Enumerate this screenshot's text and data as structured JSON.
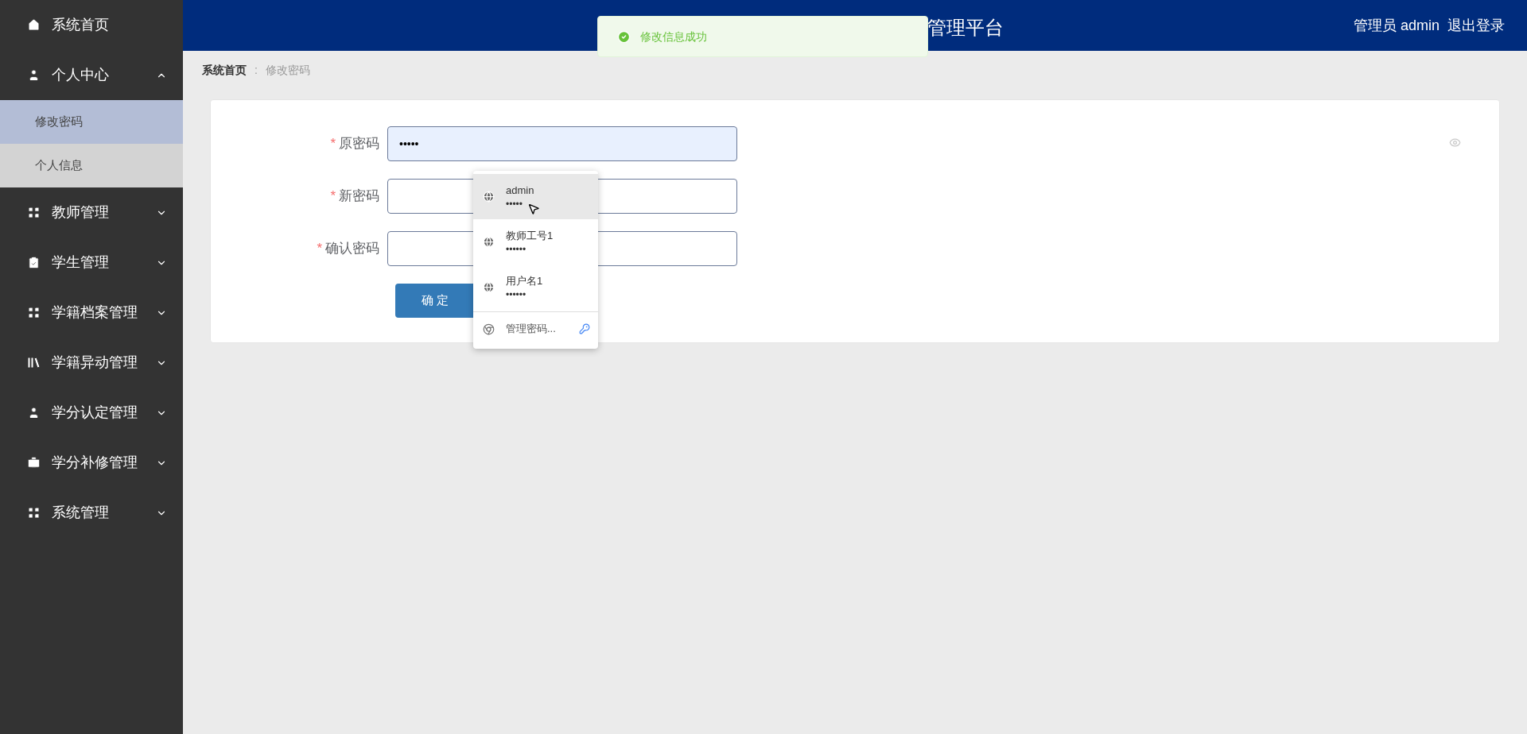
{
  "sidebar": {
    "items": [
      {
        "label": "系统首页"
      },
      {
        "label": "个人中心",
        "expanded": true,
        "children": [
          {
            "label": "修改密码",
            "selected": true
          },
          {
            "label": "个人信息",
            "selected": false
          }
        ]
      },
      {
        "label": "教师管理",
        "expanded": false
      },
      {
        "label": "学生管理",
        "expanded": false
      },
      {
        "label": "学籍档案管理",
        "expanded": false
      },
      {
        "label": "学籍异动管理",
        "expanded": false
      },
      {
        "label": "学分认定管理",
        "expanded": false
      },
      {
        "label": "学分补修管理",
        "expanded": false
      },
      {
        "label": "系统管理",
        "expanded": false
      }
    ]
  },
  "header": {
    "title": "管理平台",
    "user": "管理员 admin",
    "logout": "退出登录"
  },
  "toast": {
    "message": "修改信息成功"
  },
  "breadcrumb": {
    "separator": ":",
    "items": [
      {
        "label": "系统首页"
      },
      {
        "label": "修改密码"
      }
    ]
  },
  "form": {
    "fields": [
      {
        "label": "原密码",
        "asterisk": "*",
        "value": "•••••",
        "autofilled": true
      },
      {
        "label": "新密码",
        "asterisk": "*",
        "autofilled": false
      },
      {
        "label": "确认密码",
        "asterisk": "*",
        "autofilled": false
      }
    ],
    "submit": "确 定"
  },
  "autofill": {
    "entries": [
      {
        "username": "admin",
        "password": "•••••",
        "selected": true
      },
      {
        "username": "教师工号1",
        "password": "••••••",
        "selected": false
      },
      {
        "username": "用户名1",
        "password": "••••••",
        "selected": false
      }
    ],
    "manage": "管理密码..."
  }
}
